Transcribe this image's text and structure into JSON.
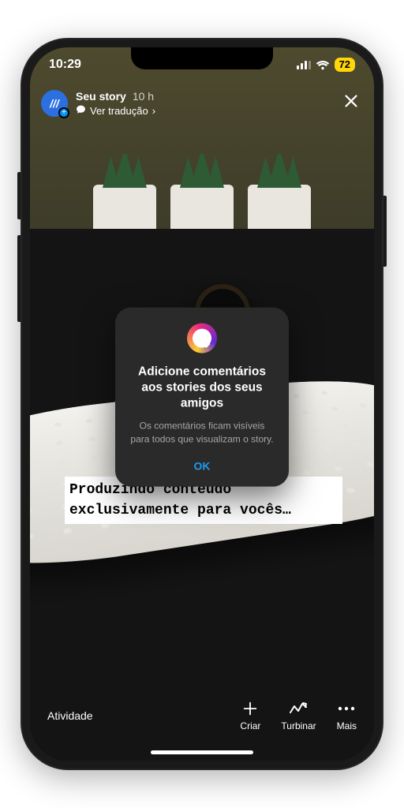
{
  "status": {
    "time": "10:29",
    "battery": "72"
  },
  "story": {
    "title": "Seu story",
    "time": "10 h",
    "translate": "Ver tradução",
    "caption": "Produzindo conteúdo exclusivamente para vocês…"
  },
  "modal": {
    "title": "Adicione comentários aos stories dos seus amigos",
    "body": "Os comentários ficam visíveis para todos que visualizam o story.",
    "ok": "OK"
  },
  "bottom": {
    "activity": "Atividade",
    "create": "Criar",
    "boost": "Turbinar",
    "more": "Mais"
  }
}
